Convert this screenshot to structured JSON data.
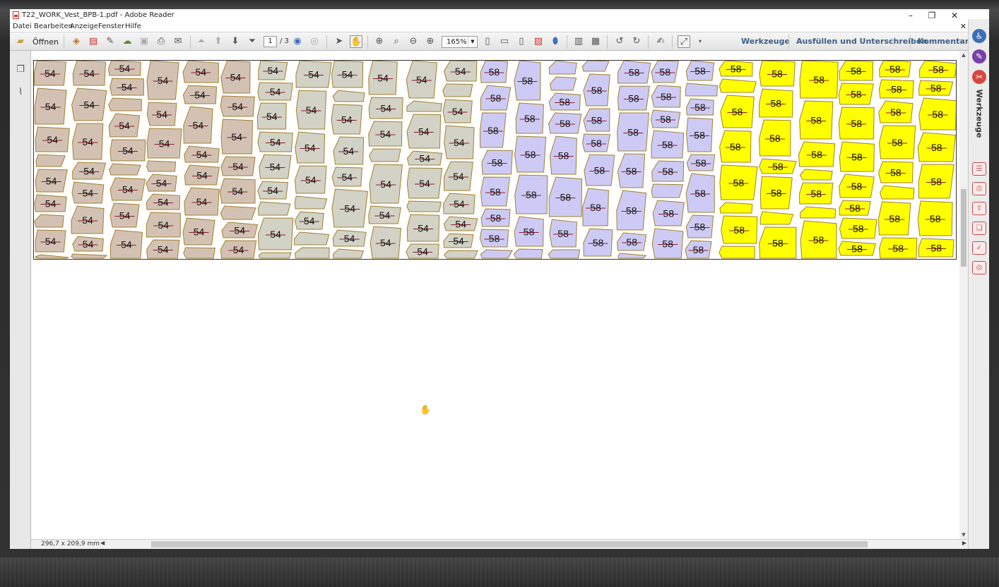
{
  "window": {
    "title": "T22_WORK_Vest_BPB-1.pdf - Adobe Reader"
  },
  "menu": [
    "Datei",
    "Bearbeiten",
    "Anzeige",
    "Fenster",
    "Hilfe"
  ],
  "toolbar": {
    "open_label": "Öffnen",
    "page_current": "1",
    "page_total": "/ 3",
    "zoom": "165%",
    "links": [
      "Werkzeuge",
      "Ausfüllen und Unterschreiben",
      "Kommentar"
    ]
  },
  "right_panel": {
    "vertical_label": "Werkzeuge"
  },
  "status": {
    "page_size": "296,7 x 209,9 mm"
  },
  "document": {
    "colors": {
      "size54_tan": "#d3c2b4",
      "size54_gray": "#d2d2c6",
      "size58_blue": "#cdcbf5",
      "size58_yellow": "#ffff00",
      "outline": "#a3802c"
    },
    "size_labels": [
      "54",
      "58"
    ]
  }
}
